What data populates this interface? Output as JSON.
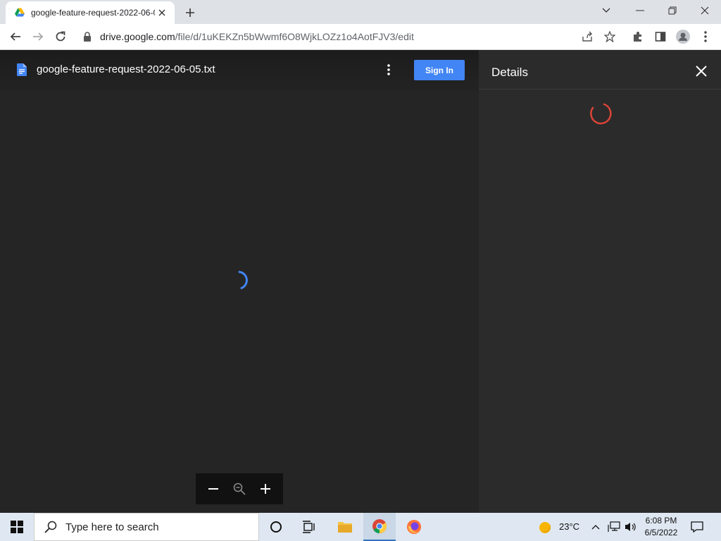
{
  "browser": {
    "tab_title": "google-feature-request-2022-06-05.txt",
    "url_host": "drive.google.com",
    "url_path": "/file/d/1uKEKZn5bWwmf6O8WjkLOZz1o4AotFJV3/edit"
  },
  "viewer": {
    "file_name": "google-feature-request-2022-06-05.txt",
    "signin_label": "Sign In",
    "details_title": "Details"
  },
  "taskbar": {
    "search_placeholder": "Type here to search",
    "temperature": "23°C",
    "time": "6:08 PM",
    "date": "6/5/2022"
  },
  "colors": {
    "accent_blue": "#4285f4",
    "spinner_blue": "#4285f4",
    "spinner_red": "#db4437"
  }
}
